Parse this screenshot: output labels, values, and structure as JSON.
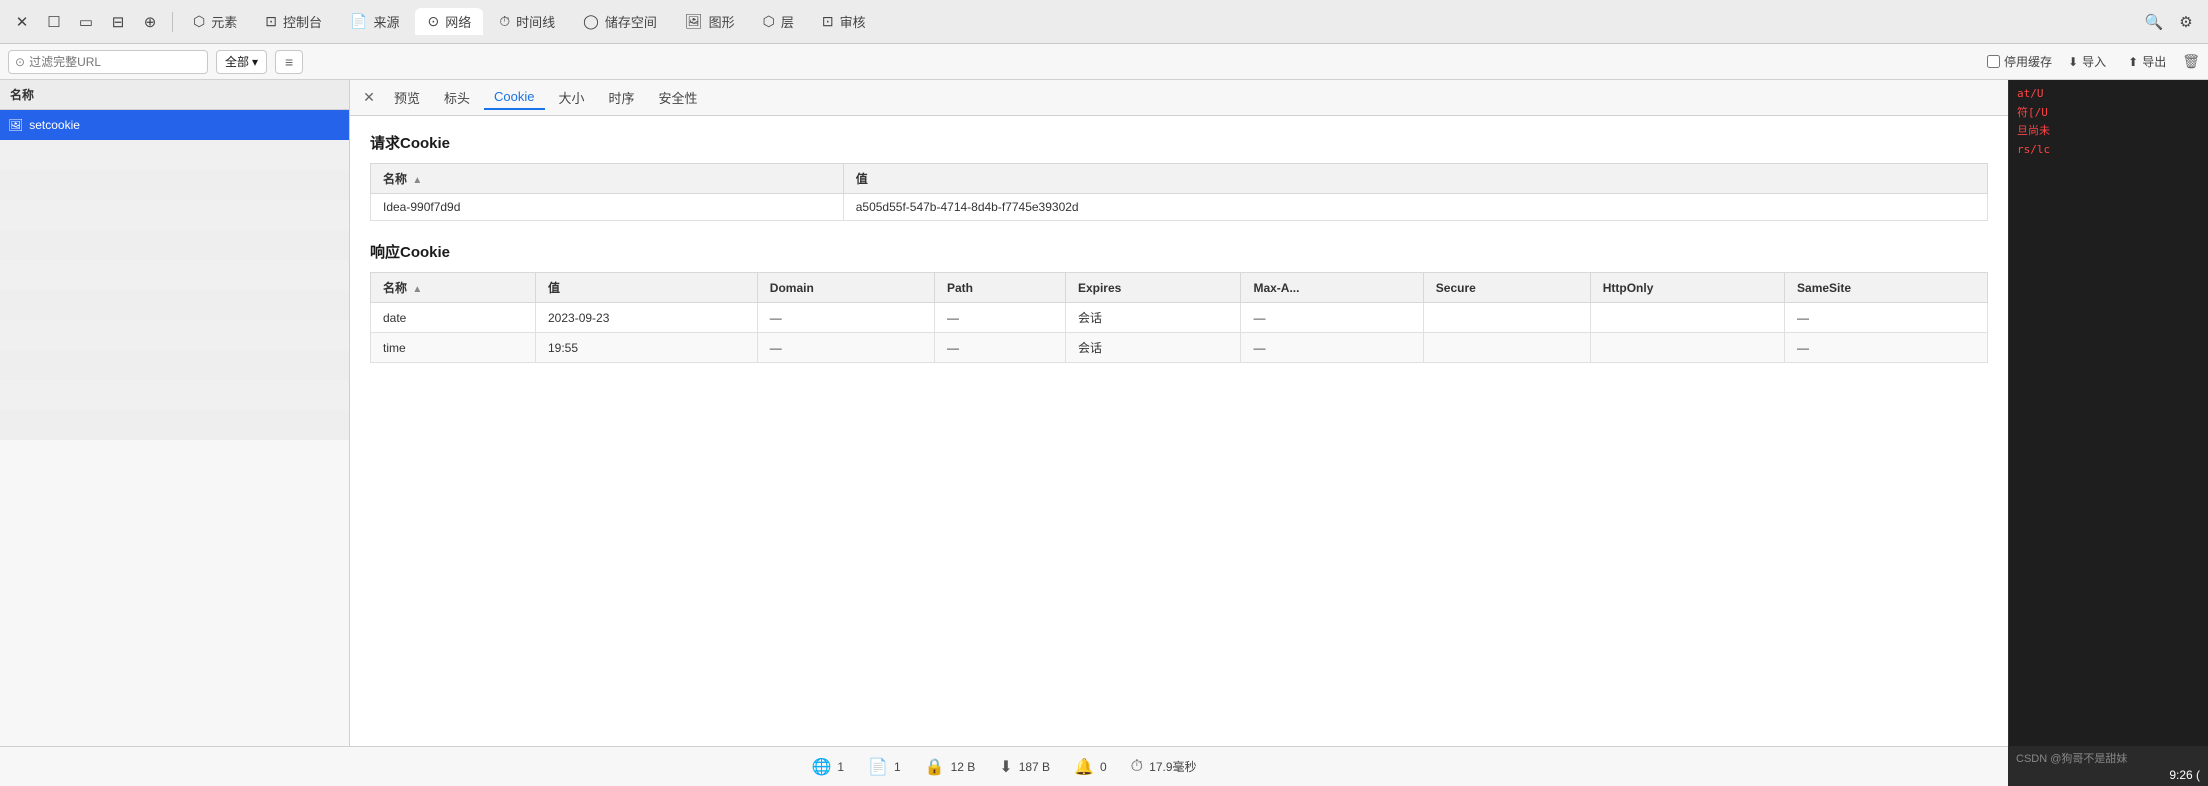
{
  "toolbar": {
    "close_label": "✕",
    "tab_rect1": "☐",
    "tab_rect2": "☐",
    "tab_share": "⊡",
    "tab_target": "⊕",
    "tabs": [
      {
        "id": "elements",
        "icon": "⬡",
        "label": "元素"
      },
      {
        "id": "console",
        "icon": "⊡",
        "label": "控制台"
      },
      {
        "id": "source",
        "icon": "⬜",
        "label": "来源"
      },
      {
        "id": "network",
        "icon": "⊙",
        "label": "网络",
        "active": true
      },
      {
        "id": "timeline",
        "icon": "⊙",
        "label": "时间线"
      },
      {
        "id": "storage",
        "icon": "◯",
        "label": "储存空间"
      },
      {
        "id": "graphics",
        "icon": "🖼",
        "label": "图形"
      },
      {
        "id": "layers",
        "icon": "⬡",
        "label": "层"
      },
      {
        "id": "audit",
        "icon": "⊡",
        "label": "审核"
      }
    ],
    "search_icon": "🔍",
    "settings_icon": "⚙"
  },
  "filter_bar": {
    "url_placeholder": "过滤完整URL",
    "all_label": "全部",
    "filter_icon": "≡",
    "disable_cache_label": "停用缓存",
    "import_label": "导入",
    "export_label": "导出",
    "trash_icon": "🗑"
  },
  "left_panel": {
    "header": "名称",
    "items": [
      {
        "name": "setcookie",
        "icon": "🖼",
        "selected": true
      }
    ]
  },
  "sub_tabs": {
    "close_icon": "✕",
    "tabs": [
      {
        "id": "preview",
        "label": "预览"
      },
      {
        "id": "headers",
        "label": "标头"
      },
      {
        "id": "cookie",
        "label": "Cookie",
        "active": true
      },
      {
        "id": "size",
        "label": "大小"
      },
      {
        "id": "timing",
        "label": "时序"
      },
      {
        "id": "security",
        "label": "安全性"
      }
    ]
  },
  "request_cookie": {
    "section_title": "请求Cookie",
    "table": {
      "columns": [
        {
          "key": "name",
          "label": "名称",
          "sortable": true
        },
        {
          "key": "value",
          "label": "值"
        }
      ],
      "rows": [
        {
          "name": "Idea-990f7d9d",
          "value": "a505d55f-547b-4714-8d4b-f7745e39302d"
        }
      ]
    }
  },
  "response_cookie": {
    "section_title": "响应Cookie",
    "table": {
      "columns": [
        {
          "key": "name",
          "label": "名称",
          "sortable": true
        },
        {
          "key": "value",
          "label": "值"
        },
        {
          "key": "domain",
          "label": "Domain"
        },
        {
          "key": "path",
          "label": "Path"
        },
        {
          "key": "expires",
          "label": "Expires"
        },
        {
          "key": "maxage",
          "label": "Max-A..."
        },
        {
          "key": "secure",
          "label": "Secure"
        },
        {
          "key": "httponly",
          "label": "HttpOnly"
        },
        {
          "key": "samesite",
          "label": "SameSite"
        }
      ],
      "rows": [
        {
          "name": "date",
          "value": "2023-09-23",
          "domain": "—",
          "path": "—",
          "expires": "会话",
          "maxage": "—",
          "secure": "",
          "httponly": "",
          "samesite": "—"
        },
        {
          "name": "time",
          "value": "19:55",
          "domain": "—",
          "path": "—",
          "expires": "会话",
          "maxage": "—",
          "secure": "",
          "httponly": "",
          "samesite": "—"
        }
      ]
    }
  },
  "bottom_bar": {
    "items": [
      {
        "icon": "🌐",
        "text": "1"
      },
      {
        "icon": "📄",
        "text": "1"
      },
      {
        "icon": "🔒",
        "text": "12 B"
      },
      {
        "icon": "⬇",
        "text": "187 B"
      },
      {
        "icon": "🔔",
        "text": "0"
      },
      {
        "icon": "⏱",
        "text": "17.9毫秒"
      }
    ]
  },
  "side_panel": {
    "lines": [
      "at/U",
      "符[/U",
      "旦尚未",
      "rs/lc"
    ]
  },
  "time_badge": "9:26 (",
  "watermark": "CSDN @狗哥不是甜妹"
}
